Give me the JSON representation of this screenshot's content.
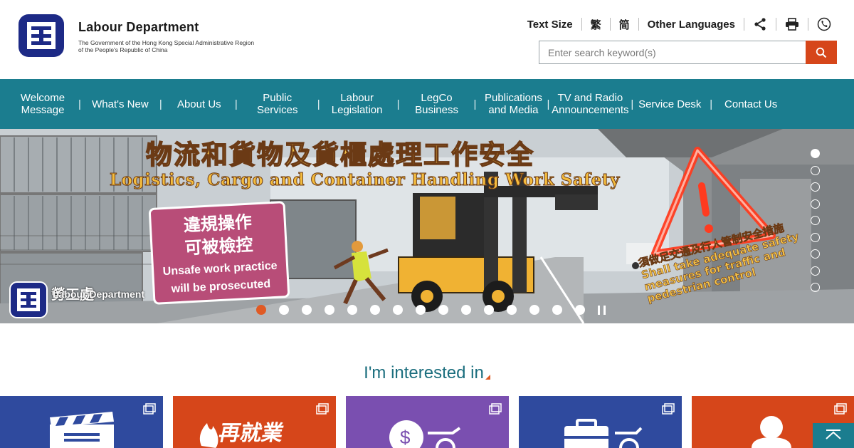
{
  "header": {
    "dept_name": "Labour Department",
    "gov_line1": "The Government of the Hong Kong Special Administrative Region",
    "gov_line2": "of the People's Republic of China"
  },
  "utility": {
    "text_size": "Text Size",
    "trad_chinese": "繁",
    "simp_chinese": "简",
    "other_languages": "Other Languages",
    "share_icon": "share-icon",
    "print_icon": "print-icon",
    "phone_icon": "phone-icon"
  },
  "search": {
    "placeholder": "Enter search keyword(s)",
    "value": "",
    "button_icon": "search-icon"
  },
  "nav": {
    "items": [
      {
        "line1": "Welcome",
        "line2": "Message"
      },
      {
        "line1": "What's New",
        "line2": ""
      },
      {
        "line1": "About Us",
        "line2": ""
      },
      {
        "line1": "Public Services",
        "line2": ""
      },
      {
        "line1": "Labour",
        "line2": "Legislation"
      },
      {
        "line1": "LegCo",
        "line2": "Business"
      },
      {
        "line1": "Publications",
        "line2": "and Media"
      },
      {
        "line1": "TV and Radio",
        "line2": "Announcements"
      },
      {
        "line1": "Service Desk",
        "line2": ""
      },
      {
        "line1": "Contact Us",
        "line2": ""
      }
    ]
  },
  "banner": {
    "title_cn": "物流和貨物及貨櫃處理工作安全",
    "title_en": "Logistics, Cargo and Container Handling Work Safety",
    "warning_cn_line1": "違規操作",
    "warning_cn_line2": "可被檢控",
    "warning_en_line1": "Unsafe work practice",
    "warning_en_line2": "will be prosecuted",
    "logo_cn": "勞工處",
    "logo_en": "Labour Department",
    "note_cn": "須做足交通及行人管制安全措施",
    "note_en": "Shall take adequate safety measures for traffic and pedestrian control",
    "slide_count": 15,
    "active_slide": 1,
    "side_count": 9,
    "side_active": 1
  },
  "interest": {
    "title": "I'm interested in"
  },
  "tiles": [
    {
      "color": "#2f4a9e",
      "icon": "clapperboard-icon"
    },
    {
      "color": "#d6461a",
      "icon": "re-employment-logo-icon"
    },
    {
      "color": "#7a4fb0",
      "icon": "dollar-wheelchair-icon"
    },
    {
      "color": "#2f4a9e",
      "icon": "briefcase-wheelchair-icon"
    },
    {
      "color": "#d6461a",
      "icon": "person-icon"
    }
  ],
  "back_to_top_icon": "chevron-up-icon"
}
